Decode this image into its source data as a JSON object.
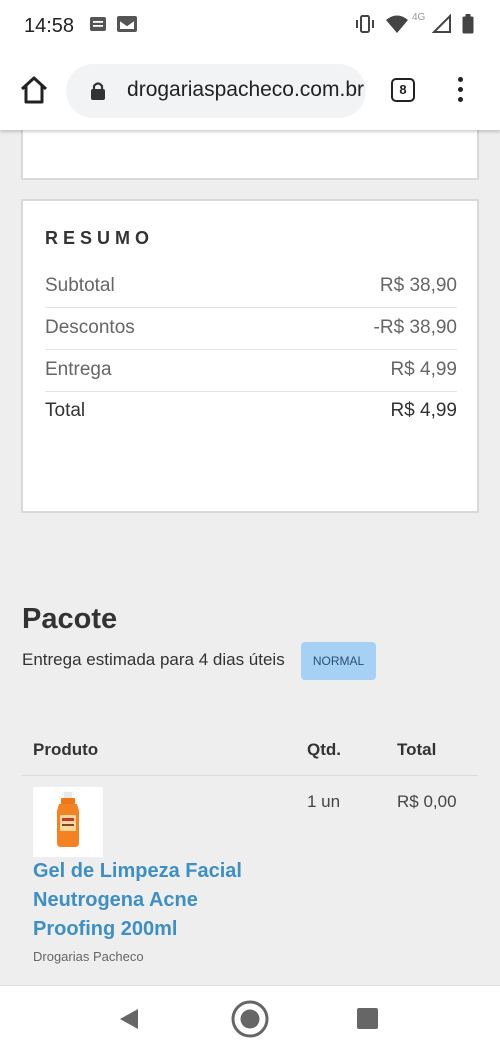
{
  "status_bar": {
    "time": "14:58",
    "network": "4G"
  },
  "browser": {
    "url": "drogariaspacheco.com.br",
    "tab_count": "8"
  },
  "summary": {
    "title": "RESUMO",
    "rows": [
      {
        "label": "Subtotal",
        "value": "R$ 38,90"
      },
      {
        "label": "Descontos",
        "value": "-R$ 38,90"
      },
      {
        "label": "Entrega",
        "value": "R$ 4,99"
      },
      {
        "label": "Total",
        "value": "R$ 4,99"
      }
    ]
  },
  "package": {
    "title": "Pacote",
    "delivery_estimate": "Entrega estimada para 4 dias úteis",
    "shipping_badge": "NORMAL",
    "table": {
      "headers": {
        "product": "Produto",
        "qty": "Qtd.",
        "total": "Total"
      },
      "items": [
        {
          "name": "Gel de Limpeza Facial Neutrogena Acne Proofing 200ml",
          "seller": "Drogarias Pacheco",
          "qty": "1 un",
          "total": "R$ 0,00"
        }
      ]
    }
  },
  "colors": {
    "link": "#3d8fc4",
    "badge_bg": "#a7d0f5",
    "page_bg": "#eeeeee"
  }
}
